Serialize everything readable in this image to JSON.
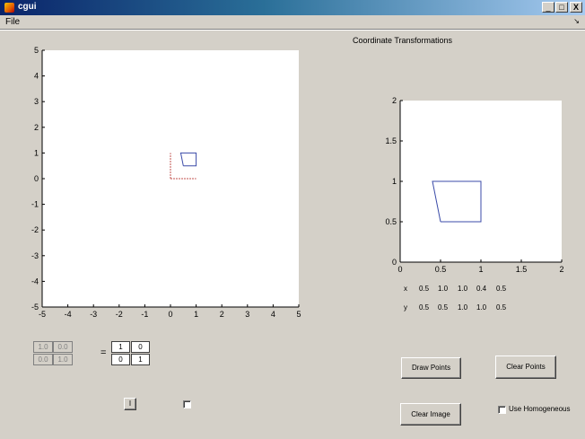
{
  "window": {
    "title": "cgui",
    "minimize": "_",
    "maximize": "□",
    "close": "X"
  },
  "menu": {
    "file": "File",
    "dock_arrow": "↘"
  },
  "figure_title": "Coordinate Transformations",
  "left_axes": {
    "xticks": [
      "-5",
      "-4",
      "-3",
      "-2",
      "-1",
      "0",
      "1",
      "2",
      "3",
      "4",
      "5"
    ],
    "yticks": [
      "5",
      "4",
      "3",
      "2",
      "1",
      "0",
      "-1",
      "-2",
      "-3",
      "-4",
      "-5"
    ]
  },
  "right_axes": {
    "xticks": [
      "0",
      "0.5",
      "1",
      "1.5",
      "2"
    ],
    "yticks": [
      "2",
      "1.5",
      "1",
      "0.5",
      "0"
    ]
  },
  "chart_data": [
    {
      "type": "line",
      "xlim": [
        -5,
        5
      ],
      "ylim": [
        -5,
        5
      ],
      "grid": false,
      "series": [
        {
          "x": [
            0.5,
            1.0,
            1.0,
            0.4,
            0.5
          ],
          "y": [
            0.5,
            0.5,
            1.0,
            1.0,
            0.5
          ],
          "color": "#3b4ba8"
        },
        {
          "x": [
            0,
            1
          ],
          "y": [
            0,
            0
          ],
          "color": "#c0504d",
          "dash": true
        },
        {
          "x": [
            0,
            0
          ],
          "y": [
            0,
            1
          ],
          "color": "#c0504d",
          "dash": true
        }
      ]
    },
    {
      "type": "line",
      "xlim": [
        0,
        2
      ],
      "ylim": [
        0,
        2
      ],
      "grid": false,
      "series": [
        {
          "x": [
            0.5,
            1.0,
            1.0,
            0.4,
            0.5
          ],
          "y": [
            0.5,
            0.5,
            1.0,
            1.0,
            0.5
          ],
          "color": "#3b4ba8"
        }
      ]
    }
  ],
  "points_table": {
    "x_label": "x",
    "x_values": [
      "0.5",
      "1.0",
      "1.0",
      "0.4",
      "0.5"
    ],
    "y_label": "y",
    "y_values": [
      "0.5",
      "0.5",
      "1.0",
      "1.0",
      "0.5"
    ]
  },
  "matrix_left": [
    "1.0",
    "0.0",
    "0.0",
    "1.0"
  ],
  "equals": "=",
  "matrix_right": [
    "1",
    "0",
    "0",
    "1"
  ],
  "small_button": "I",
  "buttons": {
    "draw_points": "Draw Points",
    "clear_points": "Clear Points",
    "clear_image": "Clear Image"
  },
  "use_homogeneous": "Use Homogeneous"
}
